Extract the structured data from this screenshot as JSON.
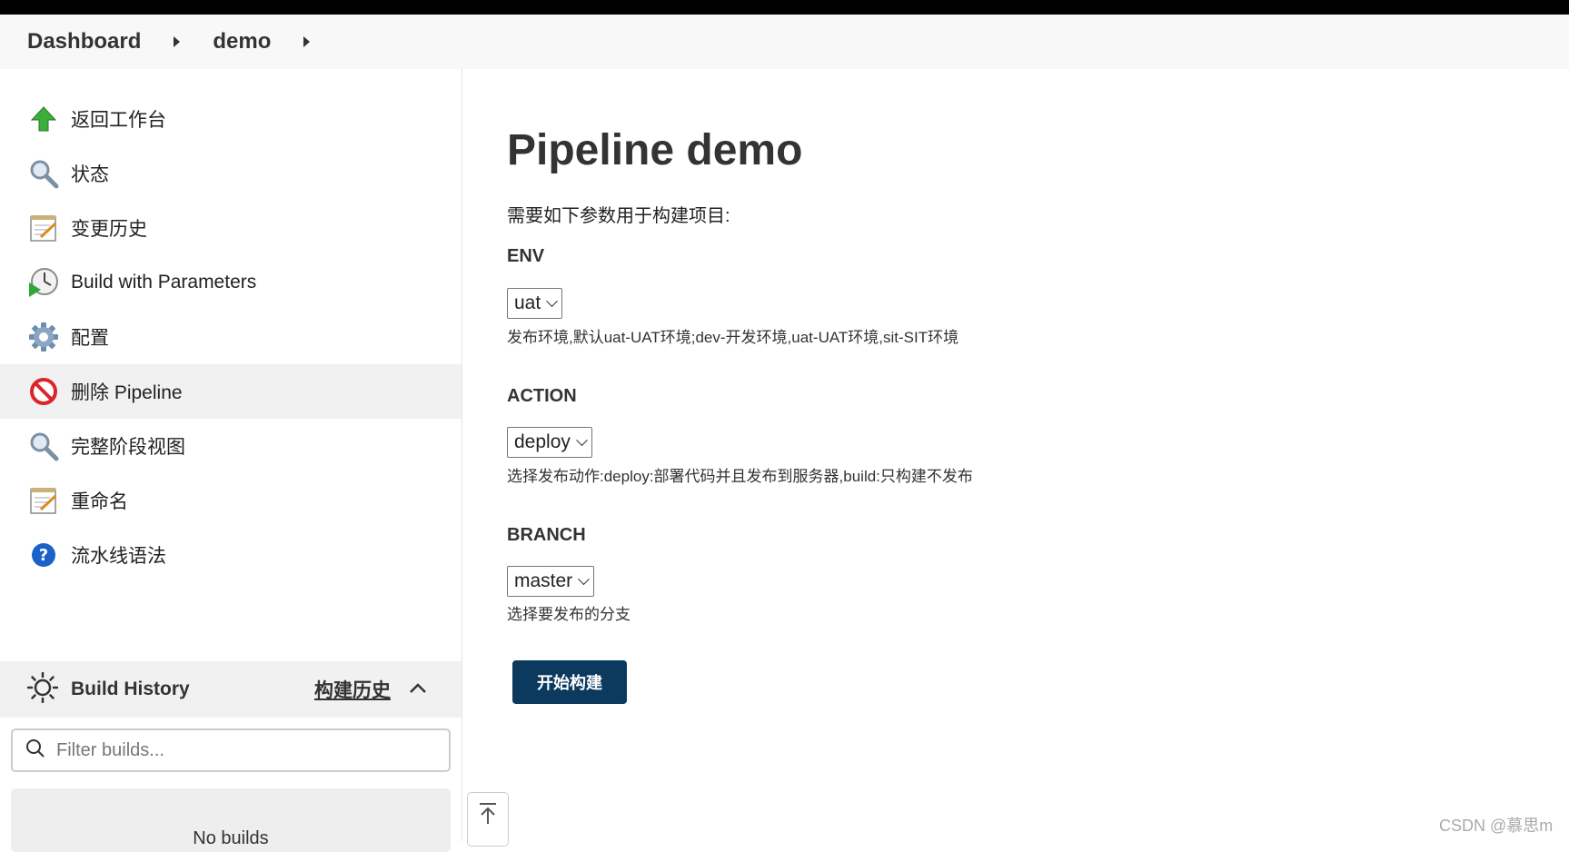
{
  "breadcrumb": {
    "items": [
      "Dashboard",
      "demo"
    ]
  },
  "sidebar": {
    "tasks": [
      {
        "label": "返回工作台",
        "icon": "up-arrow-icon"
      },
      {
        "label": "状态",
        "icon": "magnifier-icon"
      },
      {
        "label": "变更历史",
        "icon": "notepad-icon"
      },
      {
        "label": "Build with Parameters",
        "icon": "clock-play-icon"
      },
      {
        "label": "配置",
        "icon": "gear-icon"
      },
      {
        "label": "删除 Pipeline",
        "icon": "no-entry-icon"
      },
      {
        "label": "完整阶段视图",
        "icon": "magnifier-icon"
      },
      {
        "label": "重命名",
        "icon": "notepad-icon"
      },
      {
        "label": "流水线语法",
        "icon": "help-icon"
      }
    ],
    "build_history": {
      "title": "Build History",
      "link": "构建历史",
      "filter_placeholder": "Filter builds...",
      "empty_text": "No builds"
    }
  },
  "main": {
    "title": "Pipeline demo",
    "intro": "需要如下参数用于构建项目:",
    "params": [
      {
        "name": "ENV",
        "value": "uat",
        "description": "发布环境,默认uat-UAT环境;dev-开发环境,uat-UAT环境,sit-SIT环境"
      },
      {
        "name": "ACTION",
        "value": "deploy",
        "description": "选择发布动作:deploy:部署代码并且发布到服务器,build:只构建不发布"
      },
      {
        "name": "BRANCH",
        "value": "master",
        "description": "选择要发布的分支"
      }
    ],
    "build_button": "开始构建"
  },
  "watermark": "CSDN @慕思m",
  "colors": {
    "build_button": "#0b3a5e",
    "delete_icon": "#d9262b",
    "help_icon": "#1a62c9"
  }
}
